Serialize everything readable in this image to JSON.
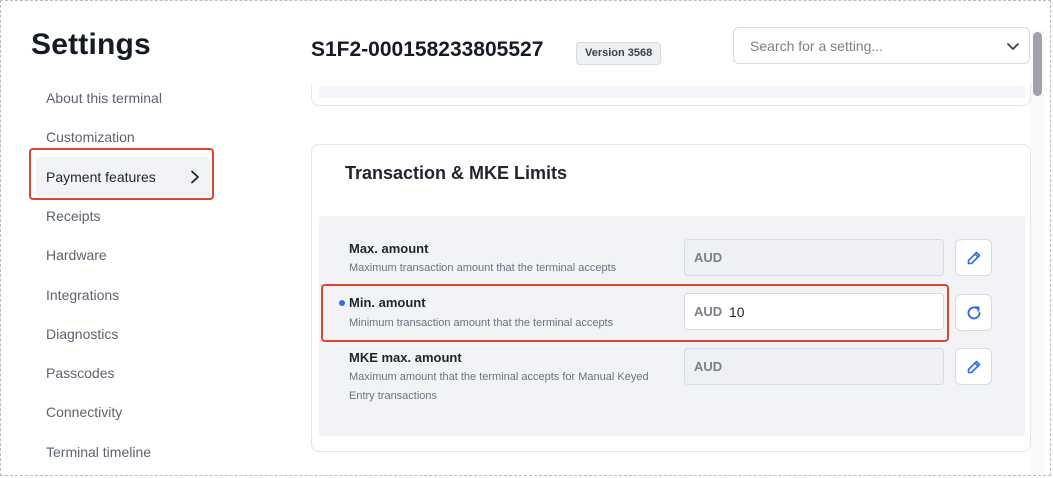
{
  "sidebar": {
    "title": "Settings",
    "items": [
      {
        "label": "About this terminal"
      },
      {
        "label": "Customization"
      },
      {
        "label": "Payment features"
      },
      {
        "label": "Receipts"
      },
      {
        "label": "Hardware"
      },
      {
        "label": "Integrations"
      },
      {
        "label": "Diagnostics"
      },
      {
        "label": "Passcodes"
      },
      {
        "label": "Connectivity"
      },
      {
        "label": "Terminal timeline"
      }
    ],
    "active_item": "Payment features"
  },
  "header": {
    "serial": "S1F2-000158233805527",
    "version_badge": "Version 3568",
    "search_placeholder": "Search for a setting..."
  },
  "section": {
    "title": "Transaction & MKE Limits",
    "rows": [
      {
        "label": "Max. amount",
        "description": "Maximum transaction amount that the terminal accepts",
        "currency": "AUD",
        "value": "",
        "action_icon": "pencil-icon"
      },
      {
        "label": "Min. amount",
        "description": "Minimum transaction amount that the terminal accepts",
        "currency": "AUD",
        "value": "10",
        "action_icon": "refresh-icon",
        "modified": true
      },
      {
        "label": "MKE max. amount",
        "description": "Maximum amount that the terminal accepts for Manual Keyed Entry transactions",
        "currency": "AUD",
        "value": "",
        "action_icon": "pencil-icon"
      }
    ]
  },
  "colors": {
    "accent": "#2f6fe4",
    "highlight": "#e0452b",
    "panel": "#f2f3f6"
  }
}
